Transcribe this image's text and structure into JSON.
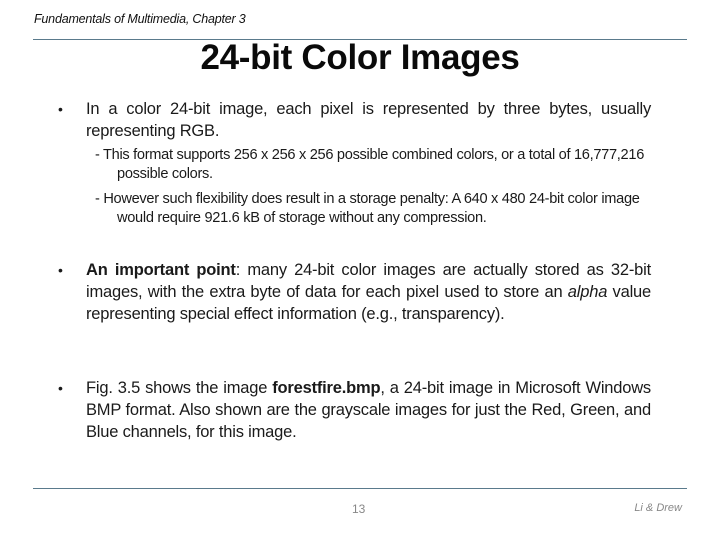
{
  "header": {
    "course": "Fundamentals of Multimedia, Chapter 3"
  },
  "title": "24-bit Color Images",
  "bullets": [
    {
      "text": "In a color 24-bit image, each pixel is represented by three bytes, usually representing RGB.",
      "subpoints": [
        "- This format supports 256 x 256 x 256 possible combined colors, or a total of 16,777,216 possible colors.",
        "- However such flexibility does result in a storage penalty: A 640 x 480 24-bit color image would require 921.6 kB of storage without any compression."
      ]
    },
    {
      "bold_lead": "An important point",
      "text_a": ": many 24-bit color images are actually stored as 32-bit images, with the extra byte of data for each pixel used to store an ",
      "italic": "alpha",
      "text_b": " value representing special effect information (e.g., transparency)."
    },
    {
      "text_a": "Fig. 3.5 shows the image ",
      "bold": "forestfire.bmp",
      "text_b": ", a 24-bit image in Microsoft Windows BMP format. Also shown are the grayscale images for just the Red, Green, and Blue channels, for this image."
    }
  ],
  "bullet_glyph": "•",
  "footer": {
    "page_number": "13",
    "authors": "Li & Drew"
  },
  "colors": {
    "rule": "#5a7a8c",
    "footer_text": "#888888"
  }
}
